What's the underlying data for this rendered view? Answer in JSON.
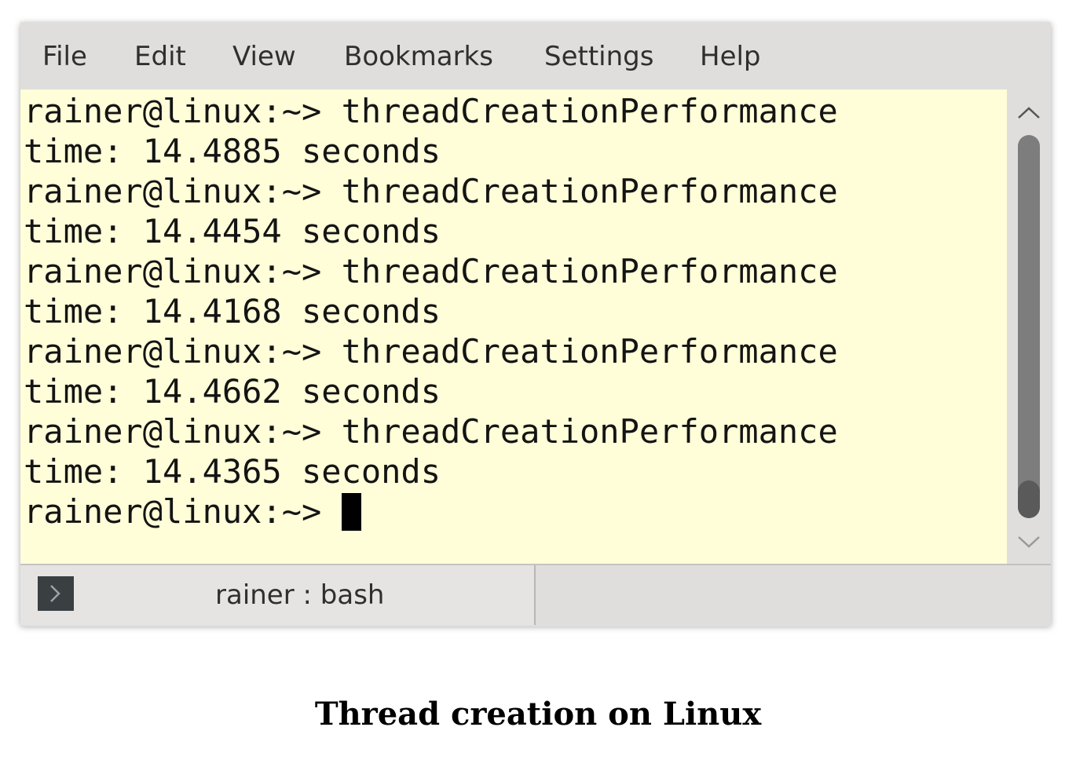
{
  "menubar": {
    "items": [
      "File",
      "Edit",
      "View",
      "Bookmarks",
      "Settings",
      "Help"
    ]
  },
  "terminal": {
    "lines": [
      "rainer@linux:~> threadCreationPerformance",
      "time: 14.4885 seconds",
      "rainer@linux:~> threadCreationPerformance",
      "time: 14.4454 seconds",
      "rainer@linux:~> threadCreationPerformance",
      "time: 14.4168 seconds",
      "rainer@linux:~> threadCreationPerformance",
      "time: 14.4662 seconds",
      "rainer@linux:~> threadCreationPerformance",
      "time: 14.4365 seconds"
    ],
    "prompt": "rainer@linux:~>",
    "background": "#fffed9"
  },
  "scrollbar": {
    "up_icon": "chevron-up-icon",
    "down_icon": "chevron-down-icon"
  },
  "tab": {
    "icon": "terminal-prompt-icon",
    "label": "rainer : bash"
  },
  "caption": "Thread creation on Linux"
}
